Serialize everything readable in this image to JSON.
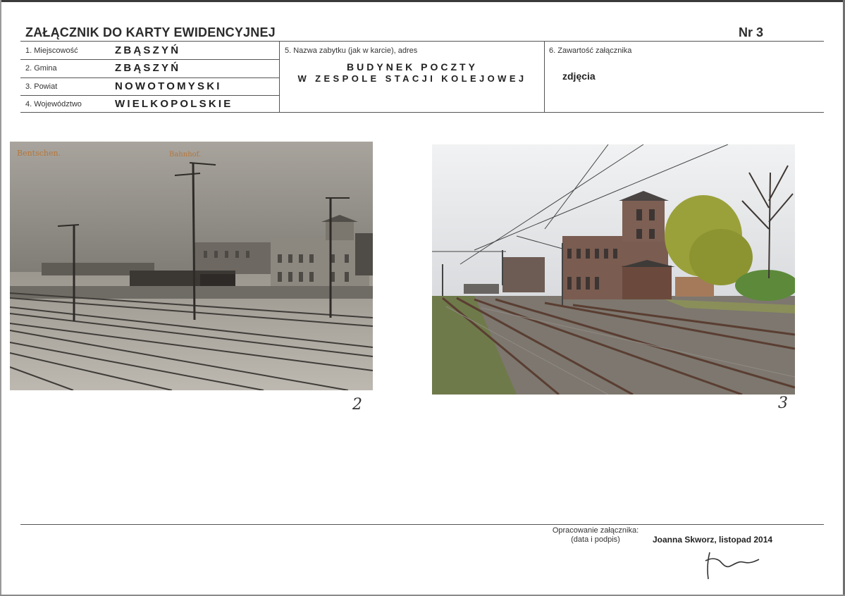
{
  "header": {
    "title": "ZAŁĄCZNIK DO KARTY EWIDENCYJNEJ",
    "number": "Nr 3"
  },
  "fields": {
    "miejscowosc": {
      "label": "1. Miejscowość",
      "value": "ZBĄSZYŃ"
    },
    "gmina": {
      "label": "2. Gmina",
      "value": "ZBĄSZYŃ"
    },
    "powiat": {
      "label": "3. Powiat",
      "value": "NOWOTOMYSKI"
    },
    "wojewodztwo": {
      "label": "4. Województwo",
      "value": "WIELKOPOLSKIE"
    },
    "nazwa": {
      "label": "5. Nazwa zabytku (jak w karcie), adres",
      "line1": "BUDYNEK POCZTY",
      "line2": "W ZESPOLE STACJI KOLEJOWEJ"
    },
    "zawartosc": {
      "label": "6. Zawartość załącznika",
      "value": "zdjęcia"
    }
  },
  "photos": [
    {
      "number": "2",
      "caption_left": "Bentschen.",
      "caption_right": "Bahnhof."
    },
    {
      "number": "3"
    }
  ],
  "footer": {
    "prepared_label": "Opracowanie załącznika:",
    "prepared_sub": "(data i podpis)",
    "author": "Joanna Skworz, listopad 2014"
  },
  "colors": {
    "sepia_sky": "#8f8c86",
    "photo_sky": "#e7e8ea",
    "brick": "#7a5c50",
    "foliage": "#9aa13a"
  }
}
